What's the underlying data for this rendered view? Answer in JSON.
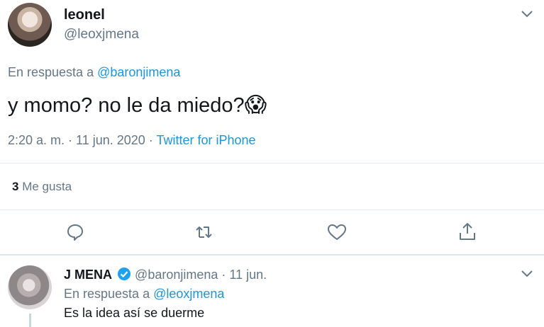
{
  "main_tweet": {
    "display_name": "leonel",
    "handle": "@leoxjmena",
    "reply_prefix": "En respuesta a",
    "reply_to": "@baronjimena",
    "text": "y momo? no le da miedo?",
    "emoji": "😱",
    "time": "2:20 a. m. · 11 jun. 2020 ·",
    "source": "Twitter for iPhone",
    "likes_count": "3",
    "likes_label": "Me gusta"
  },
  "reply_tweet": {
    "display_name": "J MENA",
    "handle": "@baronjimena",
    "date": "· 11 jun.",
    "reply_prefix": "En respuesta a",
    "reply_to": "@leoxjmena",
    "text": "Es la idea así se duerme"
  },
  "icons": {
    "chevron": "chevron-down-icon",
    "reply": "reply-icon",
    "retweet": "retweet-icon",
    "like": "heart-icon",
    "share": "share-icon",
    "verified": "verified-icon"
  },
  "colors": {
    "accent": "#1b95e0",
    "muted": "#657786",
    "divider": "#e6ecf0"
  }
}
